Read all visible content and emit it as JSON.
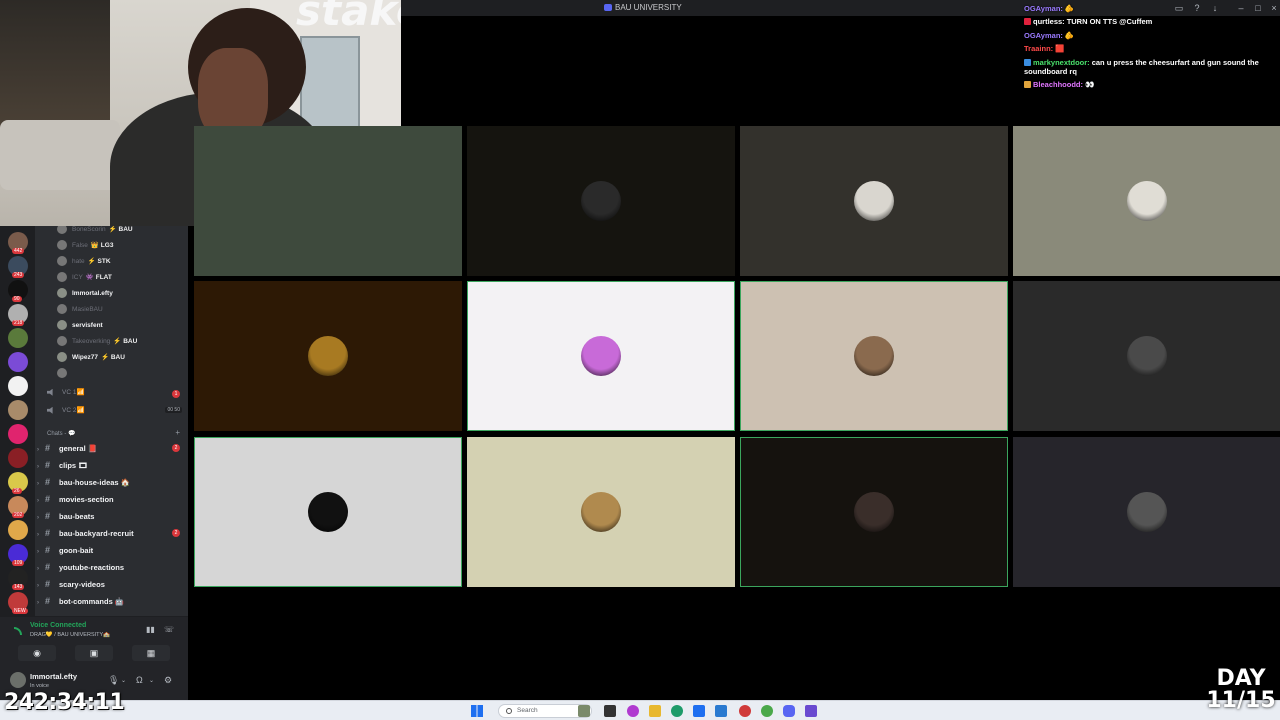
{
  "window": {
    "title": "BAU UNIVERSITY"
  },
  "webcam": {
    "logo_text": "stake"
  },
  "chat": [
    {
      "user": "OGAyman:",
      "color": "#9b7bff",
      "text": "🫵",
      "badge": ""
    },
    {
      "user": "qurtless:",
      "color": "#ffffff",
      "text": "TURN ON TTS @Cuffem",
      "badge": "#e0213c"
    },
    {
      "user": "OGAyman:",
      "color": "#9b7bff",
      "text": "🫵",
      "badge": ""
    },
    {
      "user": "Traainn:",
      "color": "#ff4a4a",
      "text": "🟥",
      "badge": ""
    },
    {
      "user": "markynextdoor:",
      "color": "#4ae26c",
      "text": "can u press the cheesurfart and gun sound the soundboard rq",
      "badge": "#3a8de0"
    },
    {
      "user": "Bleachhoodd:",
      "color": "#e176ff",
      "text": "👀",
      "badge": "#e0a43c"
    }
  ],
  "sidebar": {
    "servers": [
      {
        "badge": "442",
        "color": "#7a5b4b"
      },
      {
        "badge": "243",
        "color": "#3b4b5e"
      },
      {
        "badge": "90",
        "color": "#111111"
      },
      {
        "badge": "218",
        "color": "#b0b0b0"
      },
      {
        "badge": "",
        "color": "#5a7a3b"
      },
      {
        "badge": "",
        "color": "#7b4bd6"
      },
      {
        "badge": "",
        "color": "#f2f2f2"
      },
      {
        "badge": "",
        "color": "#a88b6a"
      },
      {
        "badge": "",
        "color": "#e0246e"
      },
      {
        "badge": "",
        "color": "#8a1f25"
      },
      {
        "badge": "26",
        "color": "#d9c84a"
      },
      {
        "badge": "202",
        "color": "#c8895b"
      },
      {
        "badge": "",
        "color": "#e0a84a"
      },
      {
        "badge": "109",
        "color": "#4a2bd6"
      },
      {
        "badge": "143",
        "color": "#222222"
      },
      {
        "badge": "NEW",
        "color": "#c03a3a"
      }
    ],
    "members": [
      {
        "name": "BoneScorin",
        "tag": "⚡ BAU",
        "dim": true
      },
      {
        "name": "False",
        "tag": "👑 LG3",
        "dim": true
      },
      {
        "name": "hate",
        "tag": "⚡ STK",
        "dim": true
      },
      {
        "name": "ICY",
        "tag": "👾 FLAT",
        "dim": true
      },
      {
        "name": "Immortal.efty",
        "tag": "",
        "dim": false
      },
      {
        "name": "MasieBAU",
        "tag": "",
        "dim": true
      },
      {
        "name": "servisfent",
        "tag": "",
        "dim": false
      },
      {
        "name": "Takeoverking",
        "tag": "⚡ BAU",
        "dim": true
      },
      {
        "name": "Wipez77",
        "tag": "⚡ BAU",
        "dim": false
      },
      {
        "name": "",
        "tag": "",
        "dim": true
      }
    ],
    "voice_channels": [
      {
        "label": "VC 1📶",
        "badge": "1"
      },
      {
        "label": "VC 2📶",
        "badge": "00 50"
      }
    ],
    "category": "Chats - 💬",
    "channels": [
      {
        "label": "general 📕",
        "badge": "2"
      },
      {
        "label": "clips 🎞",
        "badge": ""
      },
      {
        "label": "bau-house-ideas 🏠",
        "badge": ""
      },
      {
        "label": "movies-section",
        "badge": ""
      },
      {
        "label": "bau-beats",
        "badge": ""
      },
      {
        "label": "bau-backyard-recruit",
        "badge": "2"
      },
      {
        "label": "goon-bait",
        "badge": ""
      },
      {
        "label": "youtube-reactions",
        "badge": ""
      },
      {
        "label": "scary-videos",
        "badge": ""
      },
      {
        "label": "bot-commands 🤖",
        "badge": ""
      }
    ]
  },
  "voice_panel": {
    "title": "Voice Connected",
    "subtitle": "DRAG💛 / BAU UNIVERSITY🏫"
  },
  "user_panel": {
    "name": "Immortal.efty",
    "status": "In voice"
  },
  "grid": [
    {
      "bg": "#3e4a3d",
      "avatar": "",
      "speaking": false
    },
    {
      "bg": "#15140f",
      "avatar": "#2a2a2a",
      "speaking": false
    },
    {
      "bg": "#33312c",
      "avatar": "#d9d6cf",
      "speaking": false
    },
    {
      "bg": "#8a8a7a",
      "avatar": "#e0ddd5",
      "speaking": false
    },
    {
      "bg": "#2d1905",
      "avatar": "#a87a22",
      "speaking": false
    },
    {
      "bg": "#f3f2f4",
      "avatar": "#c86ad8",
      "speaking": true
    },
    {
      "bg": "#cdc1b2",
      "avatar": "#8a6a4e",
      "speaking": true
    },
    {
      "bg": "#2a2a2a",
      "avatar": "#4a4a4a",
      "speaking": false
    },
    {
      "bg": "#d6d6d6",
      "avatar": "#111111",
      "speaking": true
    },
    {
      "bg": "#d4d1b2",
      "avatar": "#b08a4e",
      "speaking": false
    },
    {
      "bg": "#15120e",
      "avatar": "#3a2e2a",
      "speaking": true
    },
    {
      "bg": "#26252b",
      "avatar": "#555555",
      "speaking": false
    }
  ],
  "taskbar": {
    "search_placeholder": "Search"
  },
  "overlay": {
    "timer": "242:34:11",
    "day_line1": "DAY",
    "day_line2": "11/15"
  }
}
